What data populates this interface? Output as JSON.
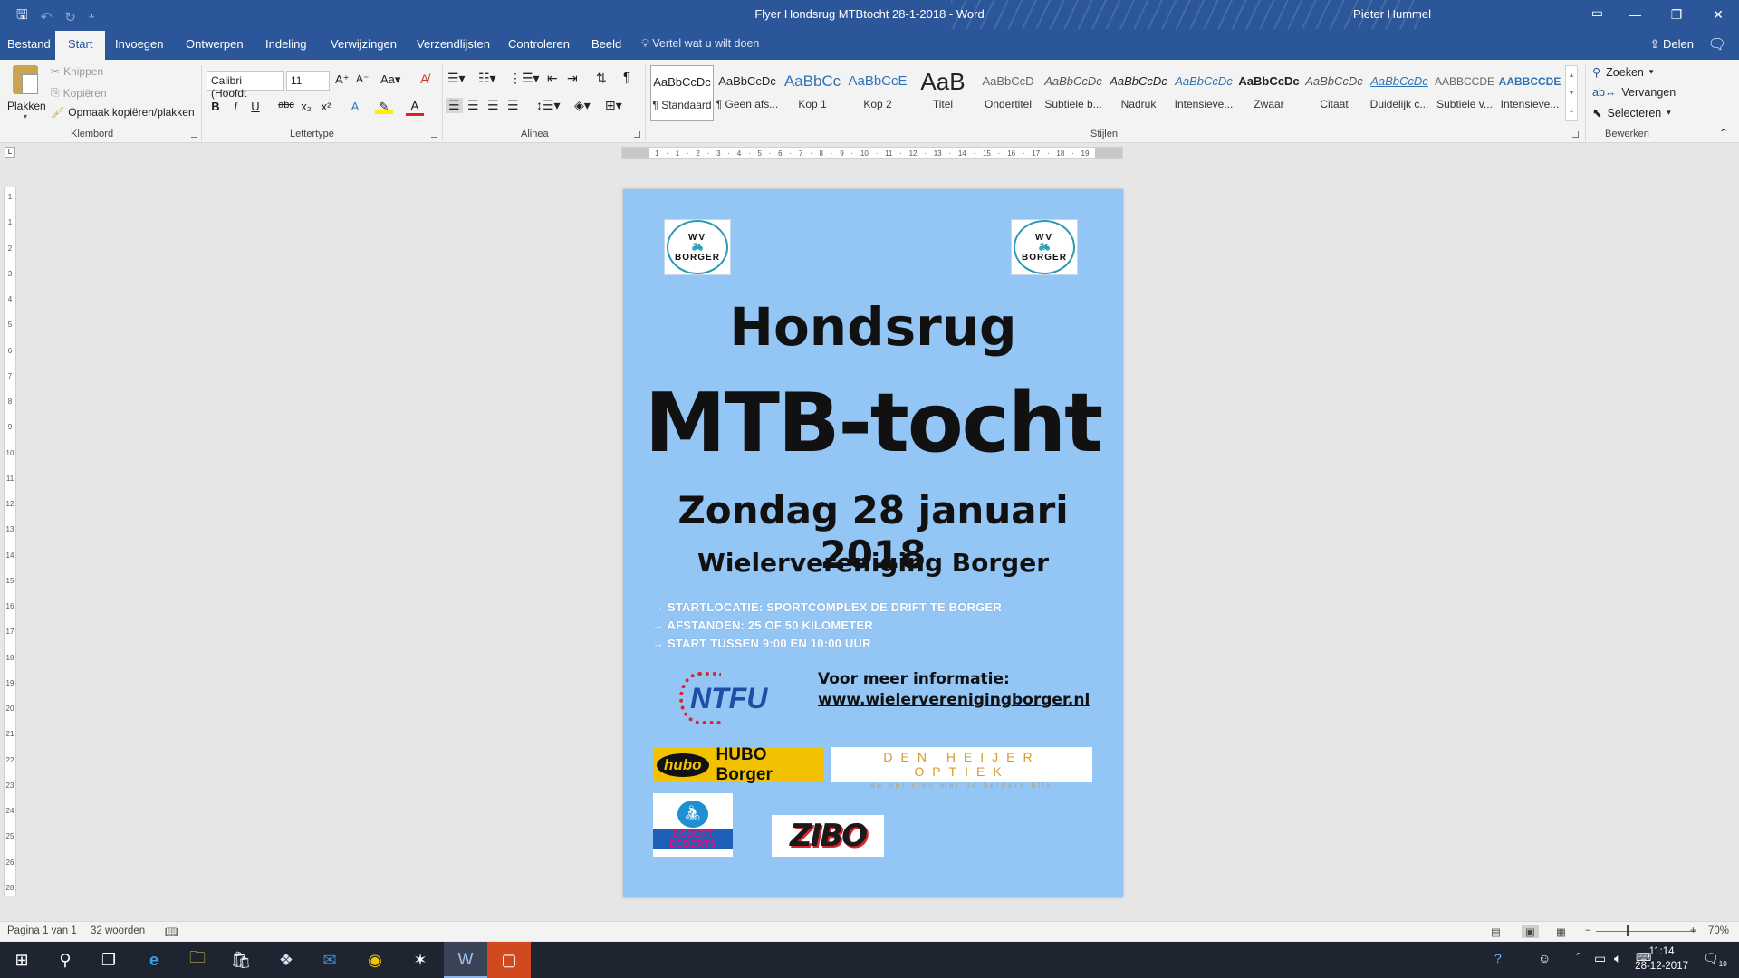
{
  "window": {
    "title": "Flyer Hondsrug MTBtocht 28-1-2018  -  Word",
    "user": "Pieter Hummel",
    "controls": [
      "—",
      "❐",
      "✕"
    ]
  },
  "qat": {
    "save": "🖫",
    "undo": "↶",
    "redo": "↻",
    "customize": "⩡"
  },
  "tabs": [
    "Bestand",
    "Start",
    "Invoegen",
    "Ontwerpen",
    "Indeling",
    "Verwijzingen",
    "Verzendlijsten",
    "Controleren",
    "Beeld"
  ],
  "active_tab": "Start",
  "tell_me": "Vertel wat u wilt doen",
  "share": "Delen",
  "ribbon": {
    "clipboard": {
      "label": "Klembord",
      "paste": "Plakken",
      "cut": "Knippen",
      "copy": "Kopiëren",
      "format_painter": "Opmaak kopiëren/plakken"
    },
    "font": {
      "label": "Lettertype",
      "name": "Calibri (Hoofdt",
      "size": "11",
      "buttons": [
        "B",
        "I",
        "U",
        "abc",
        "x₂",
        "x²"
      ]
    },
    "paragraph": {
      "label": "Alinea"
    },
    "styles": {
      "label": "Stijlen",
      "items": [
        {
          "preview": "AaBbCcDc",
          "name": "¶ Standaard"
        },
        {
          "preview": "AaBbCcDc",
          "name": "¶ Geen afs..."
        },
        {
          "preview": "AaBbCc",
          "name": "Kop 1"
        },
        {
          "preview": "AaBbCcE",
          "name": "Kop 2"
        },
        {
          "preview": "AaB",
          "name": "Titel"
        },
        {
          "preview": "AaBbCcD",
          "name": "Ondertitel"
        },
        {
          "preview": "AaBbCcDc",
          "name": "Subtiele b..."
        },
        {
          "preview": "AaBbCcDc",
          "name": "Nadruk"
        },
        {
          "preview": "AaBbCcDc",
          "name": "Intensieve..."
        },
        {
          "preview": "AaBbCcDc",
          "name": "Zwaar"
        },
        {
          "preview": "AaBbCcDc",
          "name": "Citaat"
        },
        {
          "preview": "AaBbCcDc",
          "name": "Duidelijk c..."
        },
        {
          "preview": "AABBCCDE",
          "name": "Subtiele v..."
        },
        {
          "preview": "AABBCCDE",
          "name": "Intensieve..."
        }
      ]
    },
    "editing": {
      "label": "Bewerken",
      "find": "Zoeken",
      "replace": "Vervangen",
      "select": "Selecteren"
    }
  },
  "ruler": {
    "h_ticks": [
      "1",
      "·",
      "1",
      "·",
      "2",
      "·",
      "3",
      "·",
      "4",
      "·",
      "5",
      "·",
      "6",
      "·",
      "7",
      "·",
      "8",
      "·",
      "9",
      "·",
      "10",
      "·",
      "11",
      "·",
      "12",
      "·",
      "13",
      "·",
      "14",
      "·",
      "15",
      "·",
      "16",
      "·",
      "17",
      "·",
      "18",
      "·",
      "19"
    ],
    "v_ticks": [
      "1",
      "1",
      "2",
      "3",
      "4",
      "5",
      "6",
      "7",
      "8",
      "9",
      "10",
      "11",
      "12",
      "13",
      "14",
      "15",
      "16",
      "17",
      "18",
      "19",
      "20",
      "21",
      "22",
      "23",
      "24",
      "25",
      "26",
      "28"
    ]
  },
  "document": {
    "logo_top": "WV",
    "logo_bottom": "BORGER",
    "title": "Hondsrug",
    "headline": "MTB-tocht",
    "date": "Zondag 28 januari 2018",
    "club": "Wielervereniging Borger",
    "facts": [
      "→ STARTLOCATIE: SPORTCOMPLEX DE DRIFT TE BORGER",
      "→ AFSTANDEN: 25 OF 50 KILOMETER",
      "→ START TUSSEN 9:00 EN 10:00 UUR"
    ],
    "ntfu": "NTFU",
    "info_label": "Voor meer informatie:",
    "info_url": "www.wielerverenigingborger.nl",
    "sponsors": {
      "hubo_logo": "hubo",
      "hubo_name": "HUBO Borger",
      "heijer_name": "DEN HEIJER OPTIEK",
      "heijer_tagline": "de opticien met de heldere blik",
      "egbert_name": "EGBERT EGBERTS",
      "zibo": "ZIBO"
    }
  },
  "status": {
    "page": "Pagina 1 van 1",
    "words": "32 woorden",
    "zoom": "70%"
  },
  "taskbar": {
    "time": "11:14",
    "date": "28-12-2017",
    "notifications": "10"
  }
}
